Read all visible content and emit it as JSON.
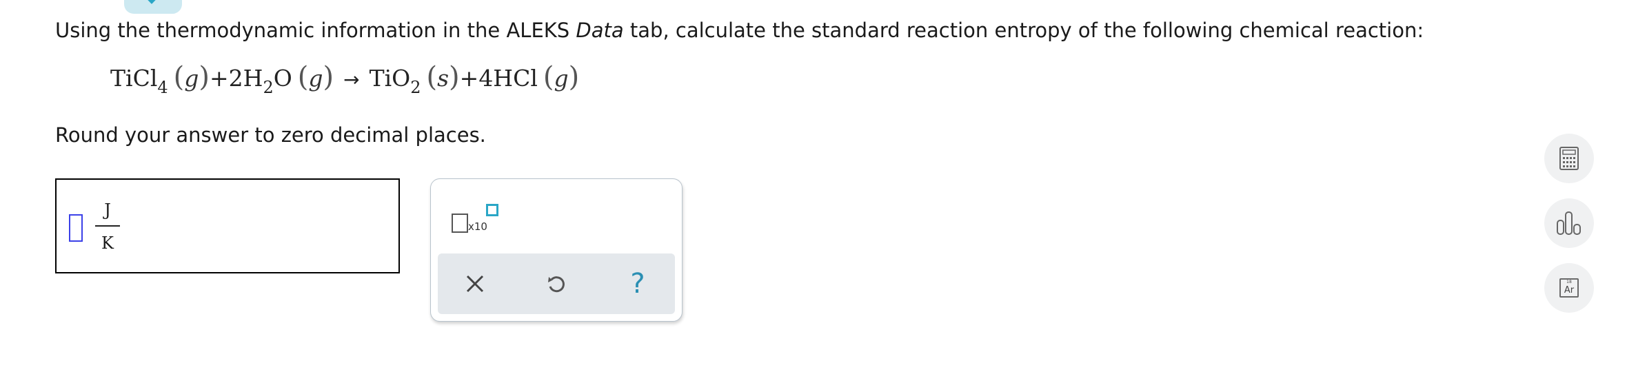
{
  "question": {
    "before_italic": "Using the thermodynamic information in the ALEKS ",
    "italic": "Data",
    "after_italic": " tab, calculate the standard reaction entropy of the following chemical reaction:"
  },
  "equation": {
    "r1_species": "TiCl",
    "r1_sub": "4",
    "r1_phase": "g",
    "plus1": "+",
    "r2_species": "2H",
    "r2_sub": "2",
    "r2_tail": "O",
    "r2_phase": "g",
    "arrow": "→",
    "p1_species": "TiO",
    "p1_sub": "2",
    "p1_phase": "s",
    "plus2": "+",
    "p2_species": "4HCl",
    "p2_phase": "g",
    "open_paren": "(",
    "close_paren": ")"
  },
  "instruction": "Round your answer to zero decimal places.",
  "answer": {
    "value": "",
    "unit_numerator": "J",
    "unit_denominator": "K"
  },
  "keypad": {
    "sci_notation_label": "x10"
  },
  "side_tools": {
    "periodic_table_number": "18",
    "periodic_table_symbol": "Ar"
  },
  "colors": {
    "accent": "#2aa6c6",
    "input_border": "#3b41e8",
    "keypad_bar": "#e4e8ec",
    "tool_bg": "#f0f1f2"
  },
  "icons": {
    "top_tab": "chevron-down-icon",
    "clear": "x-icon",
    "undo": "undo-icon",
    "help": "question-mark-icon",
    "calculator": "calculator-icon",
    "chart": "bar-chart-icon",
    "periodic_table": "periodic-table-icon"
  }
}
